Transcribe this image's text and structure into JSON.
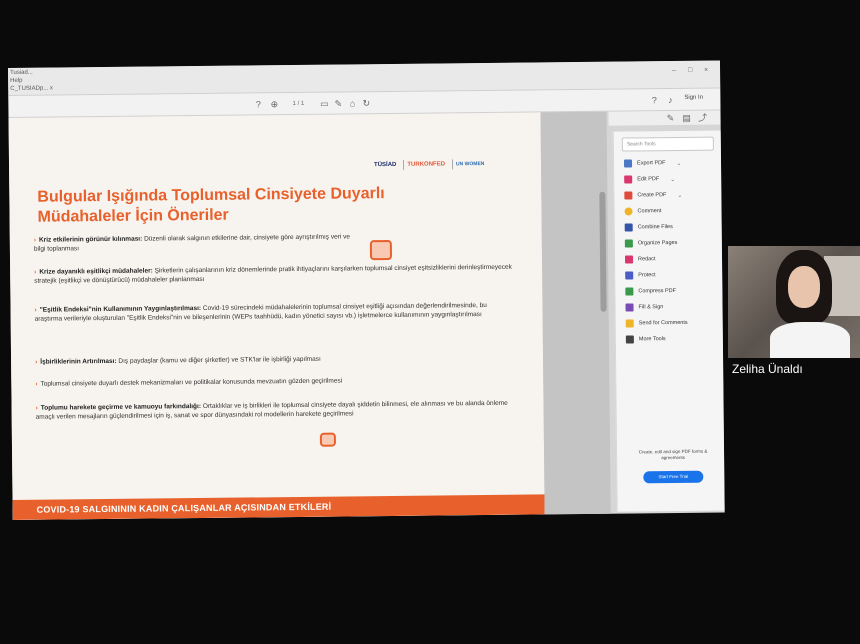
{
  "browser": {
    "tab_fragment": "Tusiad...",
    "menu_fragment_1": "Help",
    "menu_fragment_2": "C_TUSIADp... x"
  },
  "acrobat": {
    "toolbar": {
      "help_icon": "?",
      "page_indicator": "1 / 1",
      "sign_in": "Sign In"
    },
    "tools": [
      {
        "label": "Search Tools",
        "color": "#ffffff"
      },
      {
        "label": "Export PDF",
        "color": "#4a78c6"
      },
      {
        "label": "Edit PDF",
        "color": "#d9376e"
      },
      {
        "label": "Create PDF",
        "color": "#e04a3a"
      },
      {
        "label": "Comment",
        "color": "#f0b429"
      },
      {
        "label": "Combine Files",
        "color": "#3556a8"
      },
      {
        "label": "Organize Pages",
        "color": "#3a9a4c"
      },
      {
        "label": "Redact",
        "color": "#d9376e"
      },
      {
        "label": "Protect",
        "color": "#4a5cc6"
      },
      {
        "label": "Compress PDF",
        "color": "#3a9a4c"
      },
      {
        "label": "Fill & Sign",
        "color": "#7a4ab5"
      },
      {
        "label": "Send for Comments",
        "color": "#f0b429"
      },
      {
        "label": "More Tools",
        "color": "#444444"
      }
    ],
    "promo": "Create, edit and sign PDF forms & agreements",
    "trial_button": "Start Free Trial"
  },
  "slide": {
    "logos": [
      "TÜSİAD",
      "TURKONFED",
      "UN WOMEN"
    ],
    "title": "Bulgular Işığında Toplumsal Cinsiyete Duyarlı Müdahaleler İçin Öneriler",
    "bullets": [
      {
        "head": "Kriz etkilerinin görünür kılınması:",
        "body": "Düzenli olarak salgının etkilerine dair, cinsiyete göre ayrıştırılmış veri ve bilgi toplanması"
      },
      {
        "head": "Krize dayanıklı eşitlikçi müdahaleler:",
        "body": "Şirketlerin çalışanlarının kriz dönemlerinde pratik ihtiyaçlarını karşılarken toplumsal cinsiyet eşitsizliklerini derinleştirmeyecek stratejik (eşitlikçi ve dönüştürücü) müdahaleler planlanması"
      },
      {
        "head": "\"Eşitlik Endeksi\"nin Kullanımının Yaygınlaştırılması:",
        "body": "Covid-19 sürecindeki müdahalelerinin toplumsal cinsiyet eşitliği açısından değerlendirilmesinde, bu araştırma verileriyle oluşturulan \"Eşitlik Endeksi\"nin ve bileşenlerinin (WEPs taahhüdü, kadın yönetici sayısı vb.) işletmelerce kullanımının yaygınlaştırılması"
      },
      {
        "head": "İşbirliklerinin Artırılması:",
        "body": "Dış paydaşlar (kamu ve diğer şirketler) ve STK'lar ile işbirliği yapılması"
      },
      {
        "head": "",
        "body": "Toplumsal cinsiyete duyarlı destek mekanizmaları ve politikalar konusunda mevzuatın gözden geçirilmesi"
      },
      {
        "head": "Toplumu harekete geçirme ve kamuoyu farkındalığı:",
        "body": "Ortaklıklar ve iş birlikleri ile toplumsal cinsiyete dayalı şiddetin bilinmesi, ele alınması ve bu alanda önleme amaçlı verilen mesajların güçlendirilmesi için iş, sanat ve spor dünyasındaki rol modellerin harekete geçirilmesi"
      }
    ],
    "footer": "COVID-19 SALGINININ KADIN ÇALIŞANLAR AÇISINDAN ETKİLERİ"
  },
  "webcam": {
    "participant_name": "Zeliha Ünaldı"
  }
}
